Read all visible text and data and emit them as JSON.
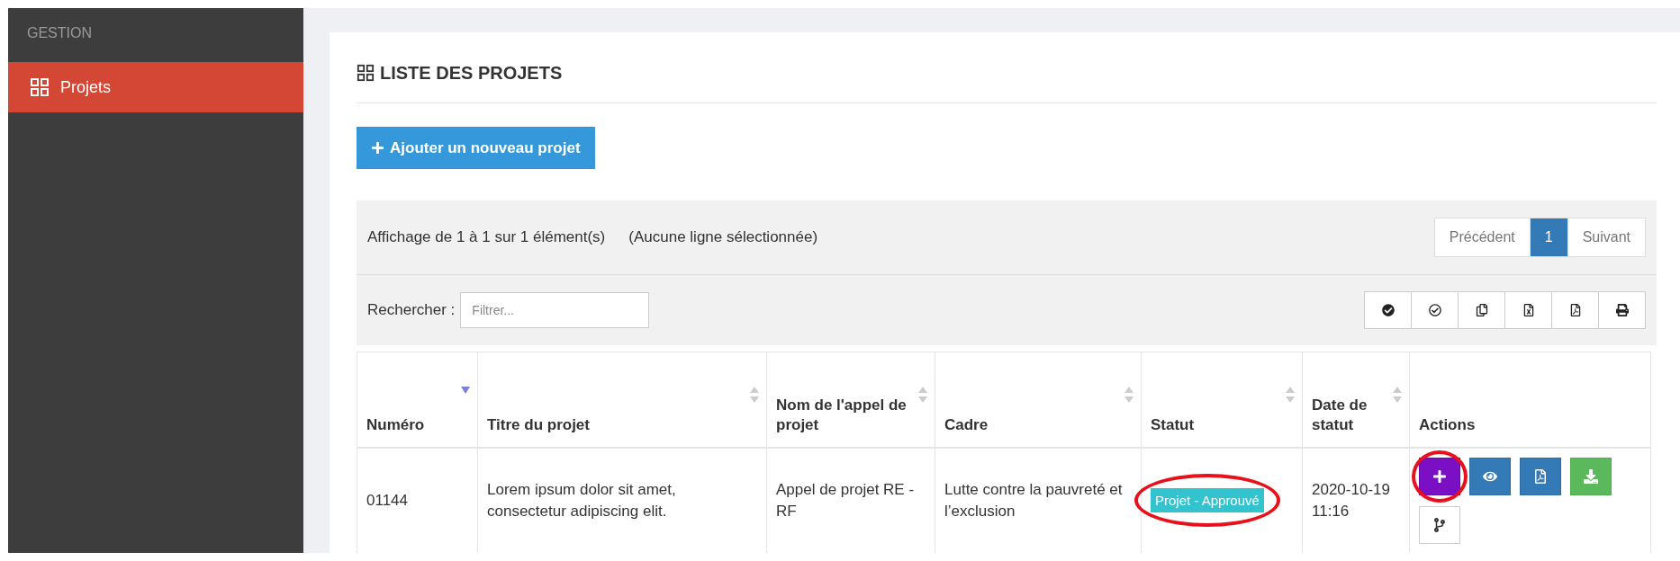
{
  "sidebar": {
    "section": "GESTION",
    "items": [
      {
        "label": "Projets",
        "selected": true
      }
    ]
  },
  "card": {
    "title": "LISTE DES PROJETS",
    "add_button": "Ajouter un nouveau projet"
  },
  "table_info": {
    "summary": "Affichage de 1 à 1 sur 1 élément(s)",
    "selection": "(Aucune ligne sélectionnée)"
  },
  "pagination": [
    {
      "label": "Précédent",
      "selected": false
    },
    {
      "label": "1",
      "selected": true
    },
    {
      "label": "Suivant",
      "selected": false
    }
  ],
  "search": {
    "label": "Rechercher :",
    "placeholder": "Filtrer..."
  },
  "toolbar": [
    {
      "kind": "select-all"
    },
    {
      "kind": "select-none"
    },
    {
      "kind": "copy"
    },
    {
      "kind": "excel"
    },
    {
      "kind": "pdf"
    },
    {
      "kind": "print"
    }
  ],
  "table": {
    "columns": [
      {
        "label": "Numéro",
        "sortable": true,
        "sorted": true
      },
      {
        "label": "Titre du projet",
        "sortable": true,
        "sorted": false
      },
      {
        "label": "Nom de l'appel de projet",
        "sortable": true,
        "sorted": false
      },
      {
        "label": "Cadre",
        "sortable": true,
        "sorted": false
      },
      {
        "label": "Statut",
        "sortable": true,
        "sorted": false
      },
      {
        "label": "Date de statut",
        "sortable": true,
        "sorted": false
      },
      {
        "label": "Actions",
        "sortable": false
      }
    ],
    "rows": [
      {
        "numero": "01144",
        "titre": "Lorem ipsum dolor sit amet, consectetur adipiscing elit.",
        "appel": "Appel de projet RE - RF",
        "cadre": "Lutte contre la pauvreté et l’exclusion",
        "statut": {
          "label": "Projet - Approuvé",
          "highlighted": true
        },
        "date": "2020-10-19 11:16",
        "actions": [
          {
            "kind": "add",
            "highlighted": true
          },
          {
            "kind": "view",
            "highlighted": false
          },
          {
            "kind": "pdf",
            "highlighted": false
          },
          {
            "kind": "download",
            "highlighted": false
          },
          {
            "kind": "fork",
            "highlighted": false
          }
        ]
      }
    ]
  }
}
